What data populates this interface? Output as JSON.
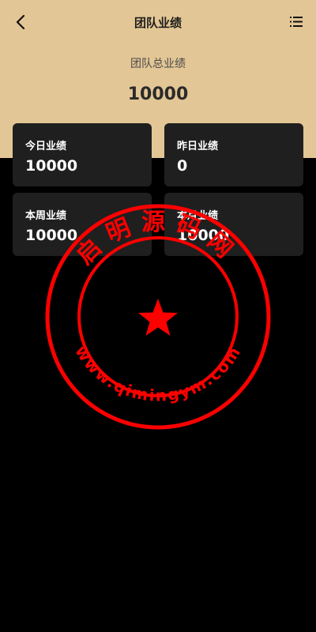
{
  "nav": {
    "back_icon": "chevron-left-icon",
    "title": "团队业绩",
    "menu_icon": "list-menu-icon"
  },
  "summary": {
    "label": "团队总业绩",
    "value": "10000"
  },
  "cards": [
    {
      "label": "今日业绩",
      "value": "10000"
    },
    {
      "label": "昨日业绩",
      "value": "0"
    },
    {
      "label": "本周业绩",
      "value": "10000"
    },
    {
      "label": "本月业绩",
      "value": "10000"
    }
  ],
  "watermark": {
    "top_text": "启明源码网",
    "bottom_text": "www.qimingym.com"
  },
  "colors": {
    "header_bg": "#e3c695",
    "page_bg": "#000000",
    "card_bg": "#1f1f1f",
    "watermark_red": "#ff0000"
  }
}
